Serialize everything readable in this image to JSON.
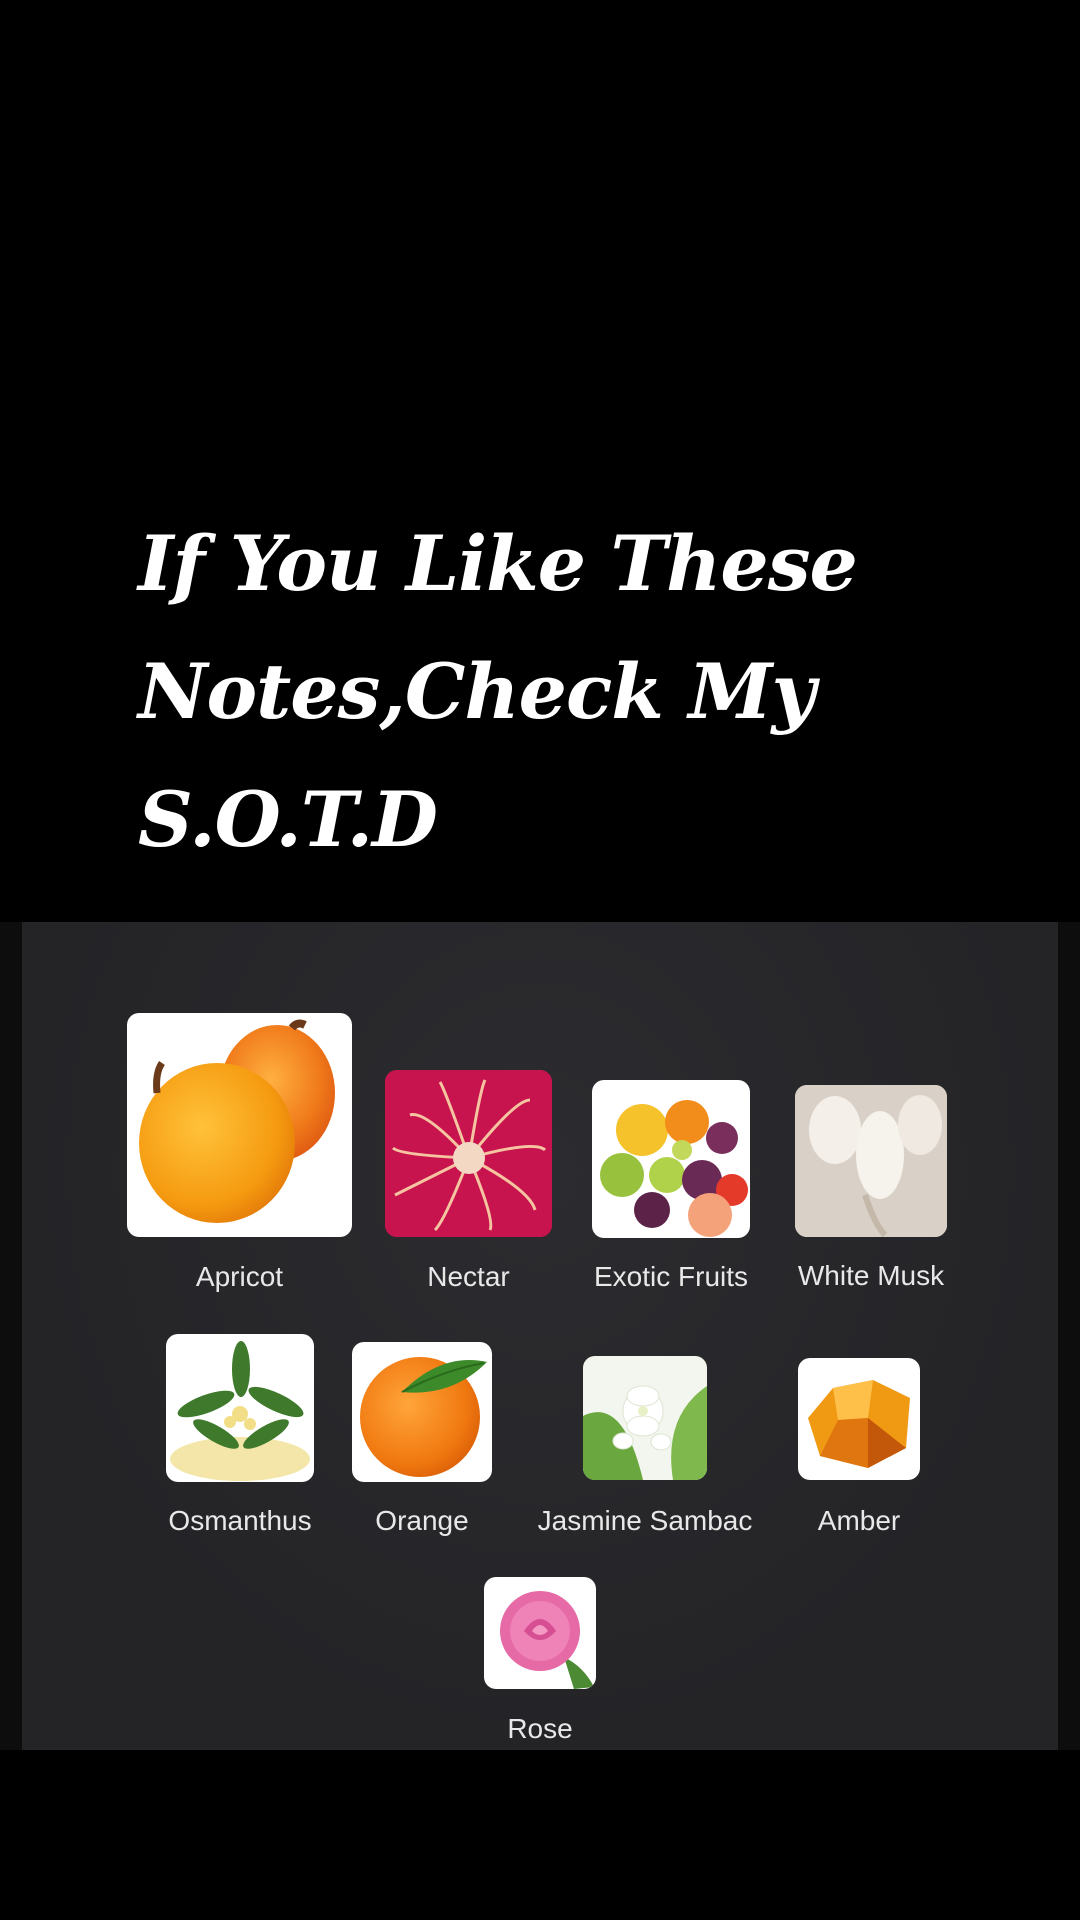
{
  "caption": {
    "line1": "If You Like These",
    "line2": "Notes,Check My",
    "line3": "S.O.T.D"
  },
  "notes": [
    {
      "name": "Apricot",
      "icon": "apricot-icon"
    },
    {
      "name": "Nectar",
      "icon": "nectar-flower-icon"
    },
    {
      "name": "Exotic Fruits",
      "icon": "exotic-fruits-icon"
    },
    {
      "name": "White Musk",
      "icon": "white-musk-icon"
    },
    {
      "name": "Osmanthus",
      "icon": "osmanthus-icon"
    },
    {
      "name": "Orange",
      "icon": "orange-icon"
    },
    {
      "name": "Jasmine Sambac",
      "icon": "jasmine-icon"
    },
    {
      "name": "Amber",
      "icon": "amber-icon"
    },
    {
      "name": "Rose",
      "icon": "rose-icon"
    }
  ],
  "colors": {
    "background": "#000000",
    "panel": "#26262a",
    "label": "#e8e8e8",
    "caption": "#ffffff"
  }
}
